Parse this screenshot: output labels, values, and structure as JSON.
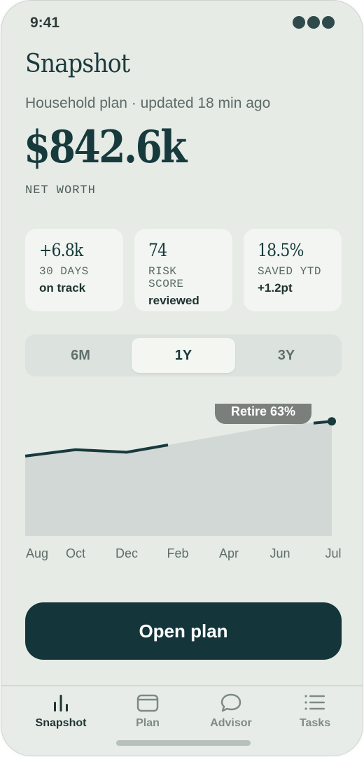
{
  "status": {
    "time": "9:41"
  },
  "header": {
    "title": "Snapshot",
    "subtitle": "Household plan · updated 18 min ago"
  },
  "summary": {
    "amount": "$842.6k",
    "label": "NET WORTH"
  },
  "cards": [
    {
      "value": "+6.8k",
      "label": "30 DAYS",
      "note": "on track"
    },
    {
      "value": "74",
      "label": "RISK SCORE",
      "note": "reviewed"
    },
    {
      "value": "18.5%",
      "label": "SAVED YTD",
      "note": "+1.2pt"
    }
  ],
  "range": {
    "options": [
      "6M",
      "1Y",
      "3Y"
    ],
    "selected": "1Y"
  },
  "chart_data": {
    "type": "area",
    "categories": [
      "Aug",
      "Oct",
      "Dec",
      "Feb",
      "Apr",
      "Jun",
      "Jul"
    ],
    "series": [
      {
        "values": [
          62,
          67,
          65,
          72,
          79,
          86,
          89
        ]
      }
    ],
    "annotation": "Retire 63%",
    "ylim": [
      0,
      100
    ],
    "title": "",
    "xlabel": "",
    "ylabel": "",
    "grid": false
  },
  "cta": {
    "label": "Open plan"
  },
  "tabs": [
    {
      "label": "Snapshot",
      "icon": "bar-chart-icon",
      "active": true
    },
    {
      "label": "Plan",
      "icon": "wallet-icon",
      "active": false
    },
    {
      "label": "Advisor",
      "icon": "chat-bubble-icon",
      "active": false
    },
    {
      "label": "Tasks",
      "icon": "list-icon",
      "active": false
    }
  ],
  "colors": {
    "background": "#e6ebe6",
    "accent": "#14353a",
    "card": "#f2f5f1",
    "area_fill": "#d2d8d6",
    "line": "#183a3d"
  }
}
